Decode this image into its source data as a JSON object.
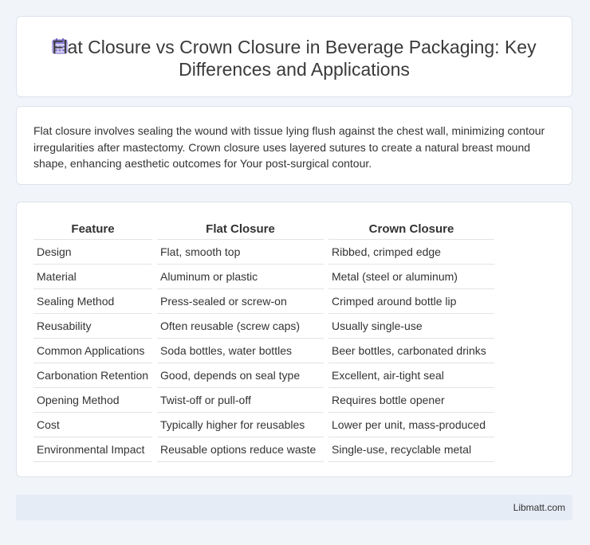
{
  "header": {
    "title": "Flat Closure vs Crown Closure in Beverage Packaging: Key Differences and Applications",
    "icon": "calendar-icon"
  },
  "description": "Flat closure involves sealing the wound with tissue lying flush against the chest wall, minimizing contour irregularities after mastectomy. Crown closure uses layered sutures to create a natural breast mound shape, enhancing aesthetic outcomes for Your post-surgical contour.",
  "table": {
    "headers": [
      "Feature",
      "Flat Closure",
      "Crown Closure"
    ],
    "rows": [
      [
        "Design",
        "Flat, smooth top",
        "Ribbed, crimped edge"
      ],
      [
        "Material",
        "Aluminum or plastic",
        "Metal (steel or aluminum)"
      ],
      [
        "Sealing Method",
        "Press-sealed or screw-on",
        "Crimped around bottle lip"
      ],
      [
        "Reusability",
        "Often reusable (screw caps)",
        "Usually single-use"
      ],
      [
        "Common Applications",
        "Soda bottles, water bottles",
        "Beer bottles, carbonated drinks"
      ],
      [
        "Carbonation Retention",
        "Good, depends on seal type",
        "Excellent, air-tight seal"
      ],
      [
        "Opening Method",
        "Twist-off or pull-off",
        "Requires bottle opener"
      ],
      [
        "Cost",
        "Typically higher for reusables",
        "Lower per unit, mass-produced"
      ],
      [
        "Environmental Impact",
        "Reusable options reduce waste",
        "Single-use, recyclable metal"
      ]
    ]
  },
  "footer": {
    "brand": "Libmatt.com"
  },
  "colors": {
    "background": "#f1f4f9",
    "footer_bg": "#e6ecf6",
    "icon_purple": "#8b7fd4"
  }
}
